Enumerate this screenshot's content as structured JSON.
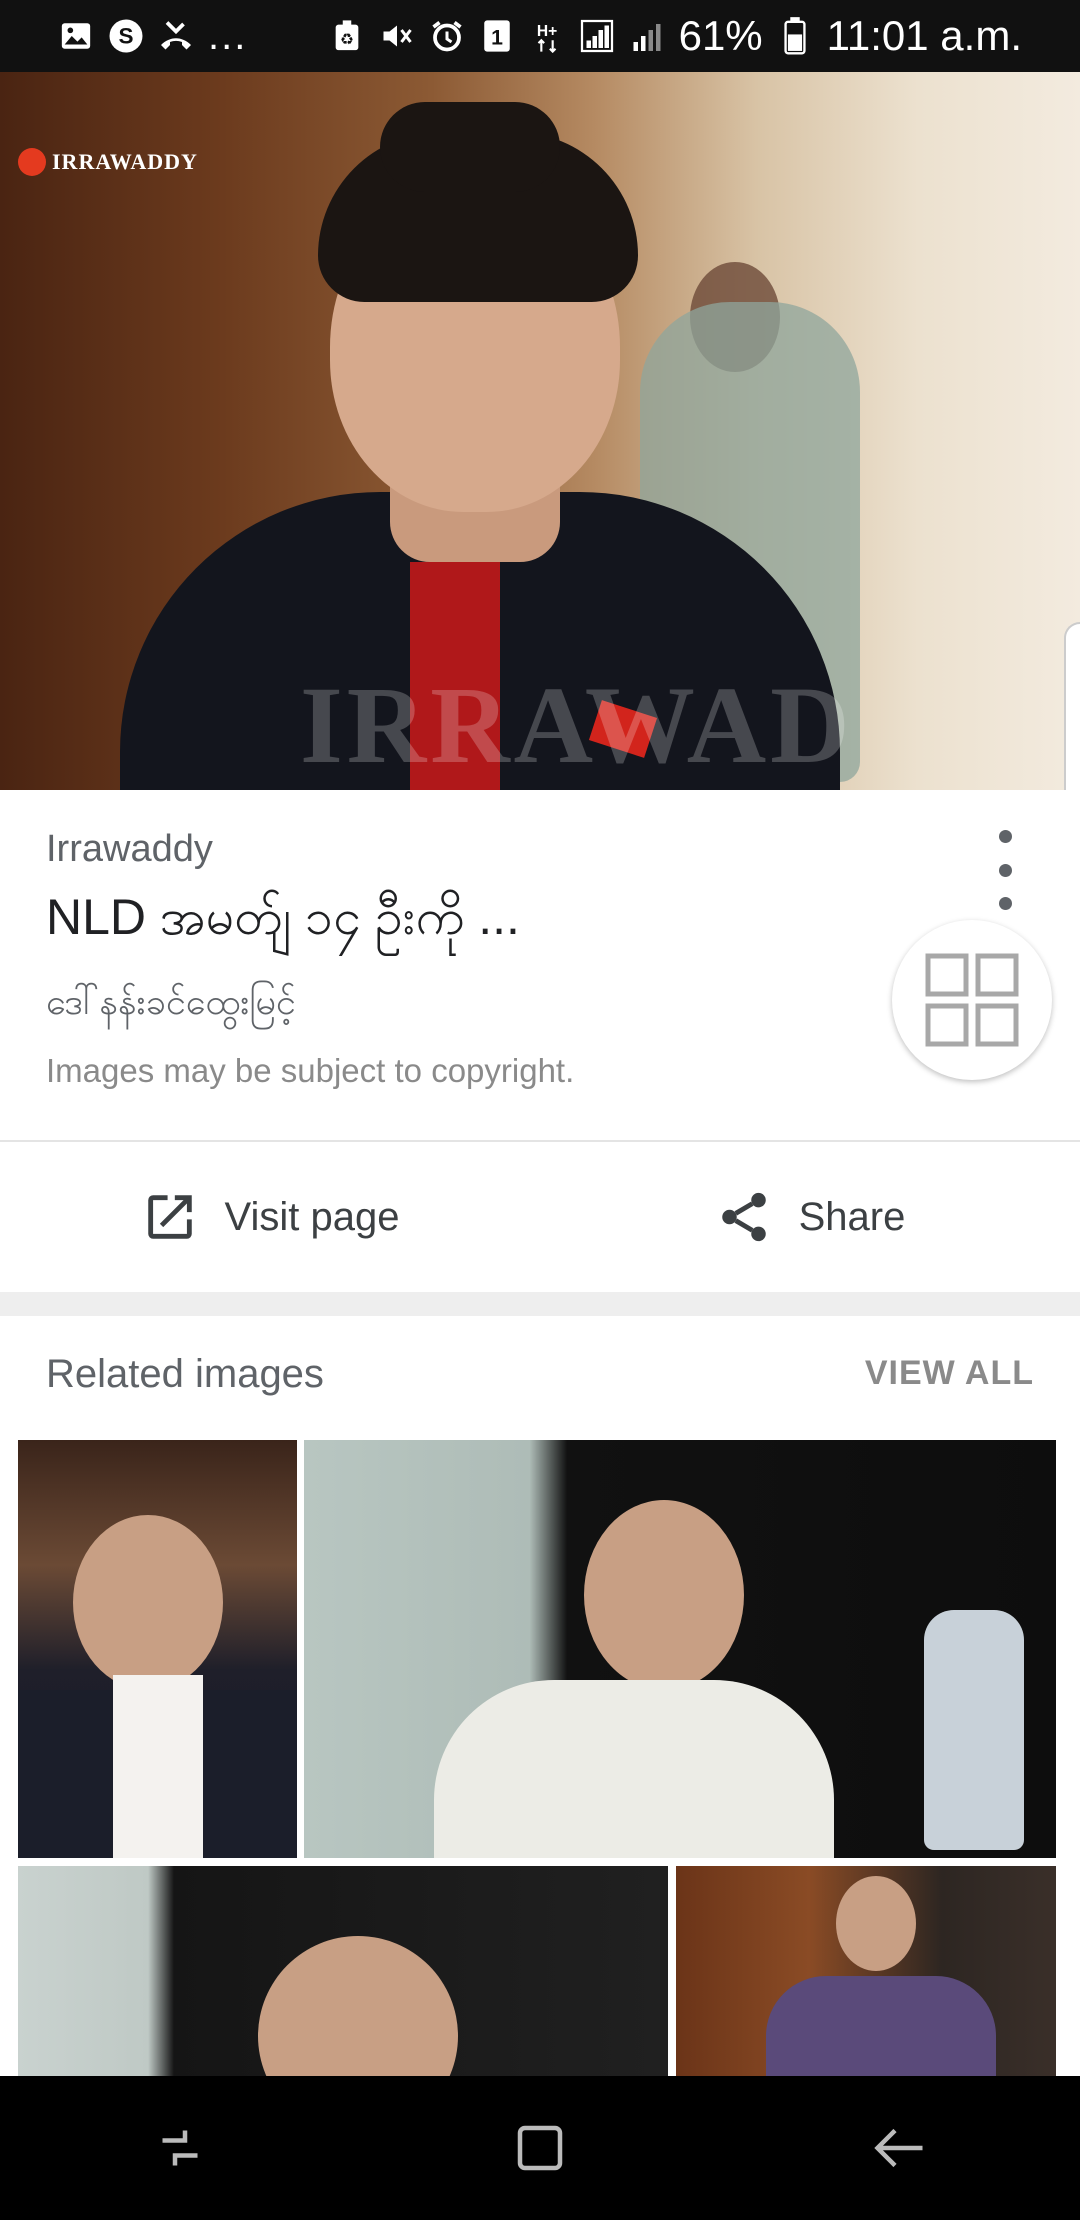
{
  "status_bar": {
    "left_icons": [
      "image-icon",
      "skype-icon",
      "missed-call-icon"
    ],
    "overflow": "...",
    "right_icons": [
      "data-saver-icon",
      "mute-icon",
      "alarm-icon",
      "sim1-icon",
      "h-plus-icon",
      "signal-icon",
      "signal2-icon",
      "battery-icon"
    ],
    "network": "H+",
    "sim": "1",
    "battery": "61%",
    "time": "11:01 a.m."
  },
  "hero": {
    "logo_text": "IRRAWADDY",
    "watermark": "IRRAWAD"
  },
  "info": {
    "source": "Irrawaddy",
    "title": "NLD အမတ်ျ ၁၄ ဦးကို ...",
    "subtitle": "ဒေါ်နန်းခင်ထွေးမြင့်",
    "copyright": "Images may be subject to copyright."
  },
  "actions": {
    "visit_label": "Visit page",
    "share_label": "Share"
  },
  "related": {
    "title": "Related images",
    "view_all": "VIEW ALL"
  },
  "colors": {
    "status_bar": "#111111",
    "nav_bar": "#000000",
    "text_primary": "#202124",
    "text_secondary": "#5f6368"
  }
}
